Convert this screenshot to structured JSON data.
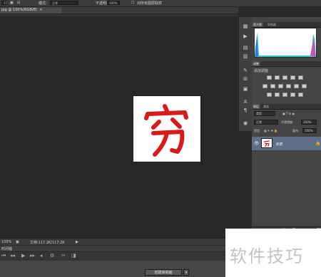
{
  "option_bar": {
    "mode_label": "模式:",
    "mode_value": "正常",
    "opacity_label": "不透明度:",
    "opacity_value": "100%",
    "flow_label": "流量:",
    "flow_value": "100%",
    "checkbox_label": "对所有图层取样"
  },
  "document": {
    "tab_title": "jpg @ 100%(RGB/8)",
    "zoom": "100%",
    "doc_info": "文档:117.2K/117.2K"
  },
  "panels": {
    "histogram_tabs": [
      "直方图",
      "导航器"
    ],
    "adjustments_tabs": [
      "调整"
    ],
    "adjustments_title": "添加调整",
    "layers_tabs": [
      "图层",
      "通道"
    ],
    "kind_filter": "类型",
    "blend_mode": "正常",
    "opacity_label": "不透明度:",
    "opacity_value": "100%",
    "lock_label": "锁定:",
    "fill_label": "填充:",
    "fill_value": "100%"
  },
  "layers": [
    {
      "name": "背景",
      "visible": true,
      "locked": true
    }
  ],
  "timeline": {
    "title": "时间轴",
    "create_button": "创建帧动画"
  },
  "canvas_image": {
    "character": "穷",
    "color": "#d81a1a"
  },
  "watermark": {
    "text": "软件技巧"
  },
  "colors": {
    "layer_selected": "#5c6f86",
    "workspace": "#282828"
  }
}
